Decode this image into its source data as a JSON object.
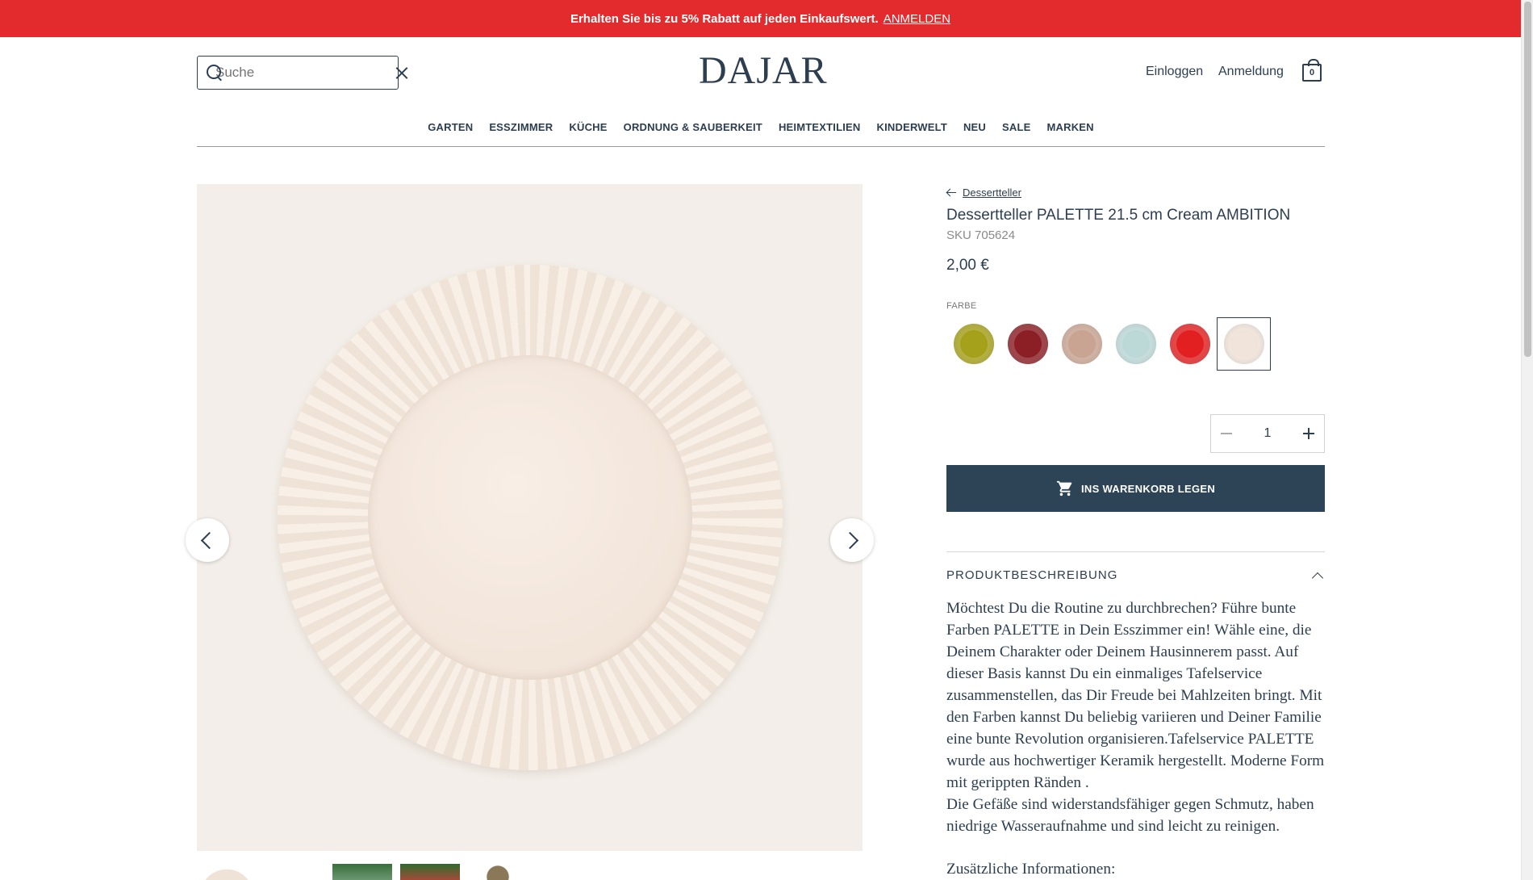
{
  "promo": {
    "text": "Erhalten Sie bis zu 5% Rabatt auf jeden Einkaufswert.",
    "link": "ANMELDEN",
    "color": "#e32b2e"
  },
  "header": {
    "search_placeholder": "Suche",
    "logo": "DAJAR",
    "login": "Einloggen",
    "register": "Anmeldung",
    "cart_count": "0"
  },
  "nav": {
    "items": [
      "GARTEN",
      "ESSZIMMER",
      "KÜCHE",
      "ORDNUNG & SAUBERKEIT",
      "HEIMTEXTILIEN",
      "KINDERWELT",
      "NEU",
      "SALE",
      "MARKEN"
    ]
  },
  "product": {
    "breadcrumb": "Dessertteller",
    "title": "Dessertteller PALETTE 21.5 cm Cream AMBITION",
    "sku": "SKU 705624",
    "price": "2,00 €",
    "color_label": "FARBE",
    "swatches": [
      {
        "name": "olive",
        "color": "#a6a11a",
        "selected": false
      },
      {
        "name": "burgundy",
        "color": "#8c1f25",
        "selected": false
      },
      {
        "name": "rose",
        "color": "#c9a492",
        "selected": false
      },
      {
        "name": "mint",
        "color": "#bcd9d8",
        "selected": false
      },
      {
        "name": "red",
        "color": "#e32021",
        "selected": false
      },
      {
        "name": "cream",
        "color": "#f1e4da",
        "selected": true
      }
    ],
    "quantity": "1",
    "add_to_cart": "INS WARENKORB LEGEN",
    "accent_color": "#2d4457"
  },
  "description": {
    "heading": "PRODUKTBESCHREIBUNG",
    "paragraph1": "Möchtest Du die Routine zu durchbrechen? Führe bunte Farben PALETTE in Dein Esszimmer ein! Wähle eine, die Deinem Charakter oder Deinem Hausinnerem passt. Auf dieser Basis kannst Du ein einmaliges Tafelservice zusammenstellen, das Dir Freude bei Mahlzeiten bringt. Mit den Farben kannst Du beliebig variieren und Deiner Familie eine bunte Revolution organisieren.Tafelservice PALETTE wurde aus hochwertiger Keramik hergestellt. Moderne Form mit gerippten Ränden .",
    "paragraph2": "Die Gefäße sind widerstandsfähiger gegen Schmutz, haben niedrige Wasseraufnahme und sind leicht zu reinigen.",
    "extra_heading": "Zusätzliche Informationen:"
  }
}
